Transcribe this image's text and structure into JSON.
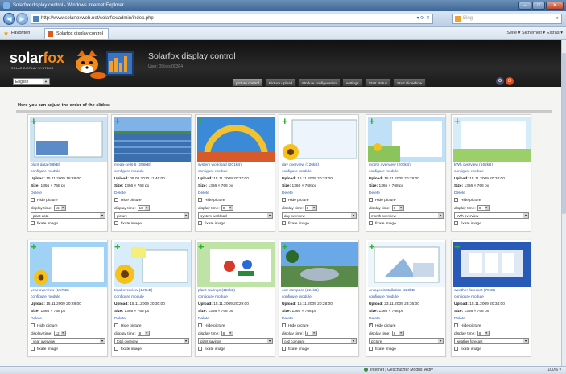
{
  "window": {
    "title": "Solarfox display control - Windows Internet Explorer",
    "url": "http://www.solarfoxweb.net/solarfox/admin/index.php",
    "search_placeholder": "Bing",
    "favorites_label": "Favoriten",
    "tab_title": "Solarfox display control",
    "commands": "Seite ▾  Sicherheit ▾  Extras ▾",
    "status_zone": "Internet | Geschützter Modus: Aktiv",
    "zoom": "100% ▾"
  },
  "app": {
    "logo_main": "solar",
    "logo_accent": "fox",
    "logo_sub": "SOLAR DISPLAY SYSTEMS",
    "title": "Solarfox display control",
    "user_line": "User: 09/sys/00304",
    "language": "English",
    "nav_tabs": [
      "picture control",
      "Picture upload",
      "Module configuration",
      "settings",
      "Start status",
      "Start slideshow"
    ],
    "instruction": "Here you can adjust the order of the slides:"
  },
  "labels": {
    "configure": "configure module",
    "upload": "Upload:",
    "size": "Size:",
    "size_value": "1366 × 768 px",
    "delete": "Delete",
    "hide_picture": "Hide picture",
    "display_time": "display time:",
    "fixate": "fixate image"
  },
  "slides": [
    {
      "name": "plant data (88kB)",
      "upload": "15.11.2009 18:28:00",
      "time": "15",
      "module": "plant data",
      "hidden": false,
      "thumb": "plant-data"
    },
    {
      "name": "mega-cells-5 (296kB)",
      "upload": "09.08.2010 11:46:00",
      "time": "10",
      "module": "picture",
      "hidden": false,
      "thumb": "solar-field"
    },
    {
      "name": "system workload (201kB)",
      "upload": "15.11.2009 20:27:00",
      "time": "8",
      "module": "system workload",
      "hidden": false,
      "thumb": "workload"
    },
    {
      "name": "day overview (126kB)",
      "upload": "15.11.2009 20:33:00",
      "time": "8",
      "module": "day overview",
      "hidden": false,
      "thumb": "sunflower"
    },
    {
      "name": "month overview (200kB)",
      "upload": "15.11.2009 20:28:00",
      "time": "8",
      "module": "month overview",
      "hidden": false,
      "thumb": "meadow"
    },
    {
      "name": "kWh overview (162kB)",
      "upload": "15.11.2009 20:34:00",
      "time": "8",
      "module": "kWh overview",
      "hidden": false,
      "thumb": "meadow2"
    },
    {
      "name": "year overview (157kB)",
      "upload": "15.11.2009 20:28:00",
      "time": "12",
      "module": "year overview",
      "hidden": false,
      "thumb": "flower-sky"
    },
    {
      "name": "total overview (189kB)",
      "upload": "15.11.2009 20:30:00",
      "time": "8",
      "module": "total overview",
      "hidden": false,
      "thumb": "sunflower-note"
    },
    {
      "name": "plant savings (156kB)",
      "upload": "15.11.2009 20:29:00",
      "time": "8",
      "module": "plant savings",
      "hidden": false,
      "thumb": "savings"
    },
    {
      "name": "co2 compare (224kB)",
      "upload": "15.11.2009 20:28:00",
      "time": "8",
      "module": "co2 compare",
      "hidden": false,
      "thumb": "car"
    },
    {
      "name": "Anlageninstallation (226kB)",
      "upload": "23.11.2009 23:36:00",
      "time": "8",
      "module": "picture",
      "hidden": true,
      "thumb": "install"
    },
    {
      "name": "weather forecast (79kB)",
      "upload": "15.11.2009 20:34:00",
      "time": "8",
      "module": "weather forecast",
      "hidden": false,
      "thumb": "weather"
    }
  ]
}
